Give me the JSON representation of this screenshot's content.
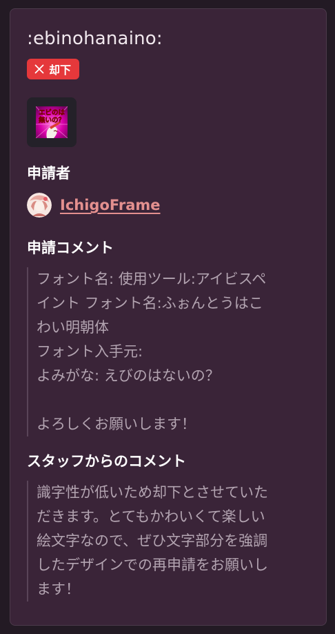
{
  "emoji": {
    "shortcode": ":ebinohanaino:",
    "status_label": "却下",
    "image_text_line1": "エビのは",
    "image_text_line2": "無いの？"
  },
  "applicant": {
    "heading": "申請者",
    "username": "IchigoFrame"
  },
  "request_comment": {
    "heading": "申請コメント",
    "lines": [
      "フォント名: 使用ツール:アイビスペ",
      "イント フォント名:ふぉんとうはこ",
      "わい明朝体",
      "フォント入手元:",
      "よみがな: えびのはないの？",
      "",
      "よろしくお願いします！"
    ]
  },
  "staff_comment": {
    "heading": "スタッフからのコメント",
    "lines": [
      "識字性が低いため却下とさせていた",
      "だきます。とてもかわいくて楽しい",
      "絵文字なので、ぜひ文字部分を強調",
      "したデザインでの再申請をお願いし",
      "ます！"
    ]
  },
  "colors": {
    "background": "#231a24",
    "card": "#3a2438",
    "badge_rejected": "#e5383b",
    "username_link": "#e4908f",
    "comment_text": "#b3a4b1"
  },
  "icons": {
    "status": "close-icon"
  }
}
